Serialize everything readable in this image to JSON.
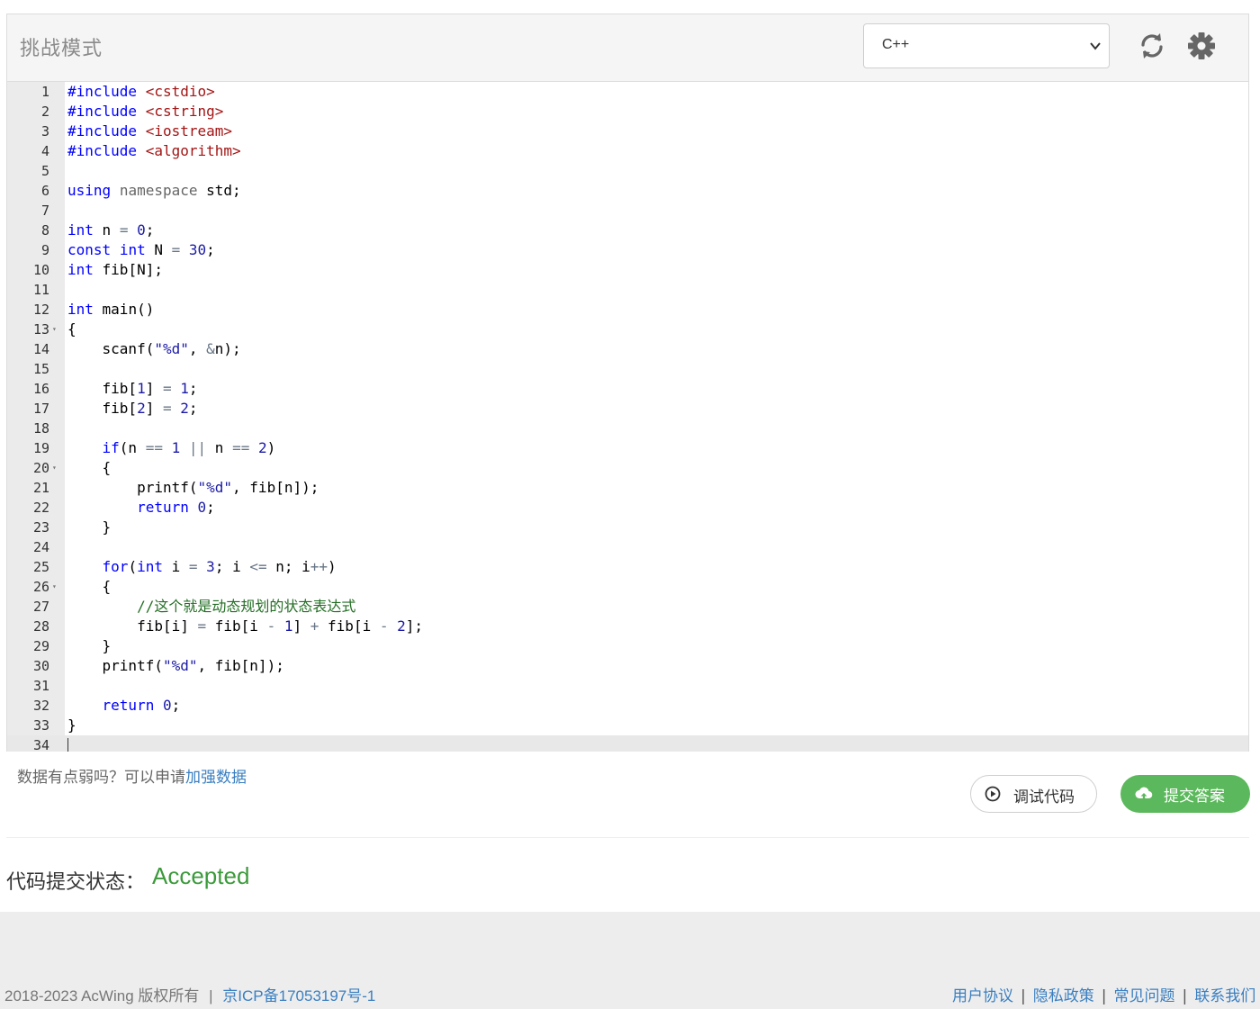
{
  "header": {
    "title": "挑战模式",
    "language": "C++"
  },
  "editor": {
    "lines": [
      {
        "n": "1",
        "fold": "",
        "html": "<span class=\"kw\">#include</span> <span style=\"color:#a31515\">&lt;cstdio&gt;</span>"
      },
      {
        "n": "2",
        "fold": "",
        "html": "<span class=\"kw\">#include</span> <span style=\"color:#a31515\">&lt;cstring&gt;</span>"
      },
      {
        "n": "3",
        "fold": "",
        "html": "<span class=\"kw\">#include</span> <span style=\"color:#a31515\">&lt;iostream&gt;</span>"
      },
      {
        "n": "4",
        "fold": "",
        "html": "<span class=\"kw\">#include</span> <span style=\"color:#a31515\">&lt;algorithm&gt;</span>"
      },
      {
        "n": "5",
        "fold": "",
        "html": ""
      },
      {
        "n": "6",
        "fold": "",
        "html": "<span class=\"kw\">using</span> <span class=\"ns\">namespace</span> std;"
      },
      {
        "n": "7",
        "fold": "",
        "html": ""
      },
      {
        "n": "8",
        "fold": "",
        "html": "<span class=\"kw\">int</span> n <span class=\"op\">=</span> <span class=\"st\">0</span>;"
      },
      {
        "n": "9",
        "fold": "",
        "html": "<span class=\"kw\">const</span> <span class=\"kw\">int</span> N <span class=\"op\">=</span> <span class=\"st\">30</span>;"
      },
      {
        "n": "10",
        "fold": "",
        "html": "<span class=\"kw\">int</span> fib[N];"
      },
      {
        "n": "11",
        "fold": "",
        "html": ""
      },
      {
        "n": "12",
        "fold": "",
        "html": "<span class=\"kw\">int</span> main()"
      },
      {
        "n": "13",
        "fold": "▾",
        "html": "{"
      },
      {
        "n": "14",
        "fold": "",
        "html": "    scanf(<span class=\"st\">\"%d\"</span>, <span class=\"op\">&amp;</span>n);"
      },
      {
        "n": "15",
        "fold": "",
        "html": ""
      },
      {
        "n": "16",
        "fold": "",
        "html": "    fib[<span class=\"st\">1</span>] <span class=\"op\">=</span> <span class=\"st\">1</span>;"
      },
      {
        "n": "17",
        "fold": "",
        "html": "    fib[<span class=\"st\">2</span>] <span class=\"op\">=</span> <span class=\"st\">2</span>;"
      },
      {
        "n": "18",
        "fold": "",
        "html": ""
      },
      {
        "n": "19",
        "fold": "",
        "html": "    <span class=\"kw\">if</span>(n <span class=\"op\">==</span> <span class=\"st\">1</span> <span class=\"op\">||</span> n <span class=\"op\">==</span> <span class=\"st\">2</span>)"
      },
      {
        "n": "20",
        "fold": "▾",
        "html": "    {"
      },
      {
        "n": "21",
        "fold": "",
        "html": "        printf(<span class=\"st\">\"%d\"</span>, fib[n]);"
      },
      {
        "n": "22",
        "fold": "",
        "html": "        <span class=\"kw\">return</span> <span class=\"st\">0</span>;"
      },
      {
        "n": "23",
        "fold": "",
        "html": "    }"
      },
      {
        "n": "24",
        "fold": "",
        "html": ""
      },
      {
        "n": "25",
        "fold": "",
        "html": "    <span class=\"kw\">for</span>(<span class=\"kw\">int</span> i <span class=\"op\">=</span> <span class=\"st\">3</span>; i <span class=\"op\">&lt;=</span> n; i<span class=\"op\">++</span>)"
      },
      {
        "n": "26",
        "fold": "▾",
        "html": "    {"
      },
      {
        "n": "27",
        "fold": "",
        "html": "        <span class=\"cm\">//这个就是动态规划的状态表达式</span>"
      },
      {
        "n": "28",
        "fold": "",
        "html": "        fib[i] <span class=\"op\">=</span> fib[i <span class=\"op\">-</span> <span class=\"st\">1</span>] <span class=\"op\">+</span> fib[i <span class=\"op\">-</span> <span class=\"st\">2</span>];"
      },
      {
        "n": "29",
        "fold": "",
        "html": "    }"
      },
      {
        "n": "30",
        "fold": "",
        "html": "    printf(<span class=\"st\">\"%d\"</span>, fib[n]);"
      },
      {
        "n": "31",
        "fold": "",
        "html": ""
      },
      {
        "n": "32",
        "fold": "",
        "html": "    <span class=\"kw\">return</span> <span class=\"st\">0</span>;"
      },
      {
        "n": "33",
        "fold": "",
        "html": "}"
      },
      {
        "n": "34",
        "fold": "",
        "html": ""
      }
    ]
  },
  "hint": {
    "text": "数据有点弱吗？可以申请",
    "link": "加强数据"
  },
  "buttons": {
    "debug": "调试代码",
    "submit": "提交答案"
  },
  "status": {
    "label": "代码提交状态：",
    "value": "Accepted",
    "value_color": "#3c9a3c"
  },
  "footer": {
    "copyright": "2018-2023 AcWing 版权所有",
    "sep": "|",
    "icp": "京ICP备17053197号-1",
    "links": [
      "用户协议",
      "隐私政策",
      "常见问题",
      "联系我们"
    ]
  },
  "colors": {
    "accent_green": "#5cb85c",
    "link_blue": "#3a7fc1"
  }
}
